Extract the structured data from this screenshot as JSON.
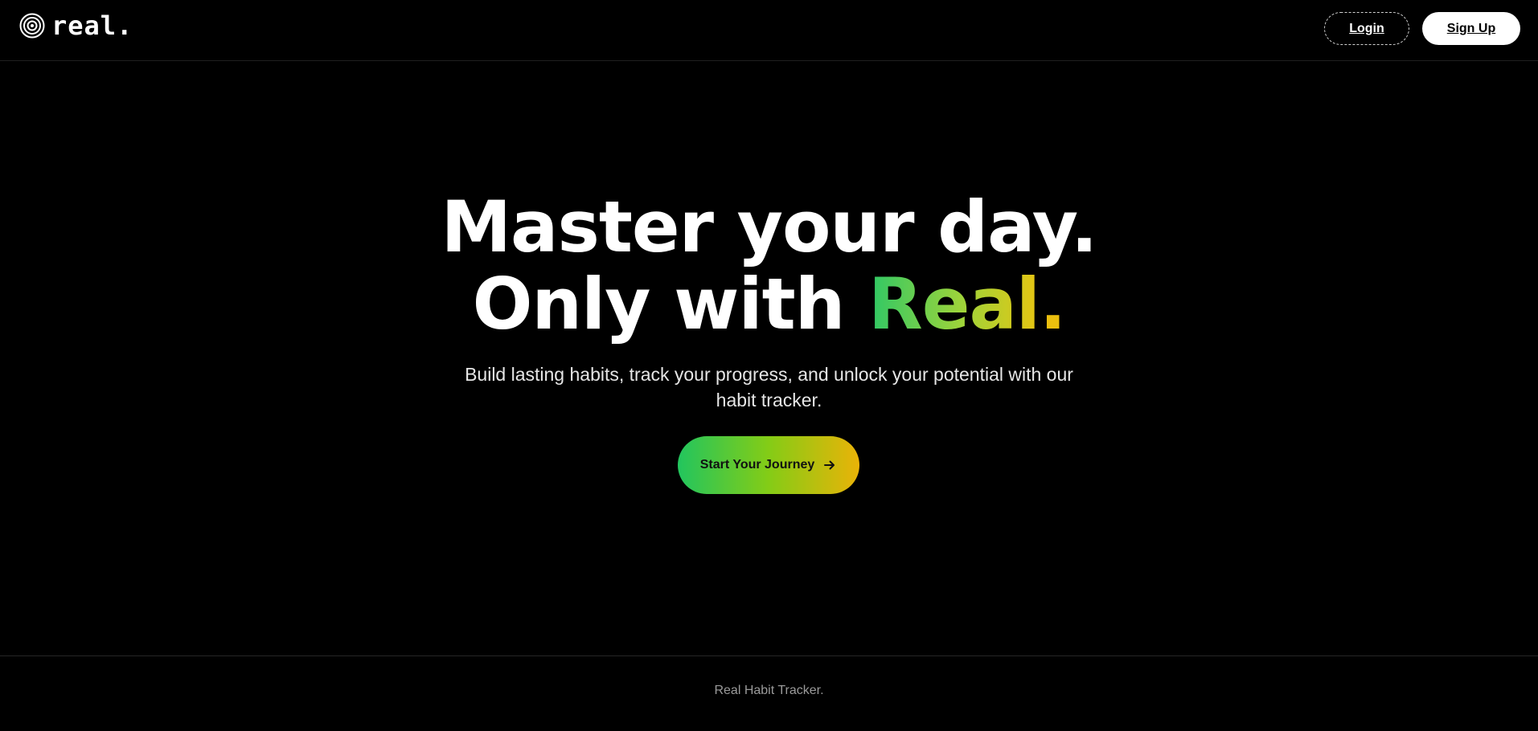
{
  "header": {
    "brand": {
      "name": "real.",
      "icon": "concentric-target-icon"
    },
    "login_label": "Login",
    "signup_label": "Sign Up"
  },
  "hero": {
    "headline_line1": "Master your day.",
    "headline_line2_prefix": "Only with ",
    "headline_accent": "Real",
    "headline_dot": ".",
    "subtext": "Build lasting habits, track your progress, and unlock your potential with our habit tracker.",
    "cta_label": "Start Your Journey",
    "cta_icon": "arrow-right-icon"
  },
  "footer": {
    "text": "Real Habit Tracker."
  },
  "colors": {
    "background": "#000000",
    "accent_green": "#22c55e",
    "accent_lime": "#84cc16",
    "accent_yellow": "#eab308",
    "text_primary": "#ffffff",
    "text_muted": "#9a9a9a"
  }
}
